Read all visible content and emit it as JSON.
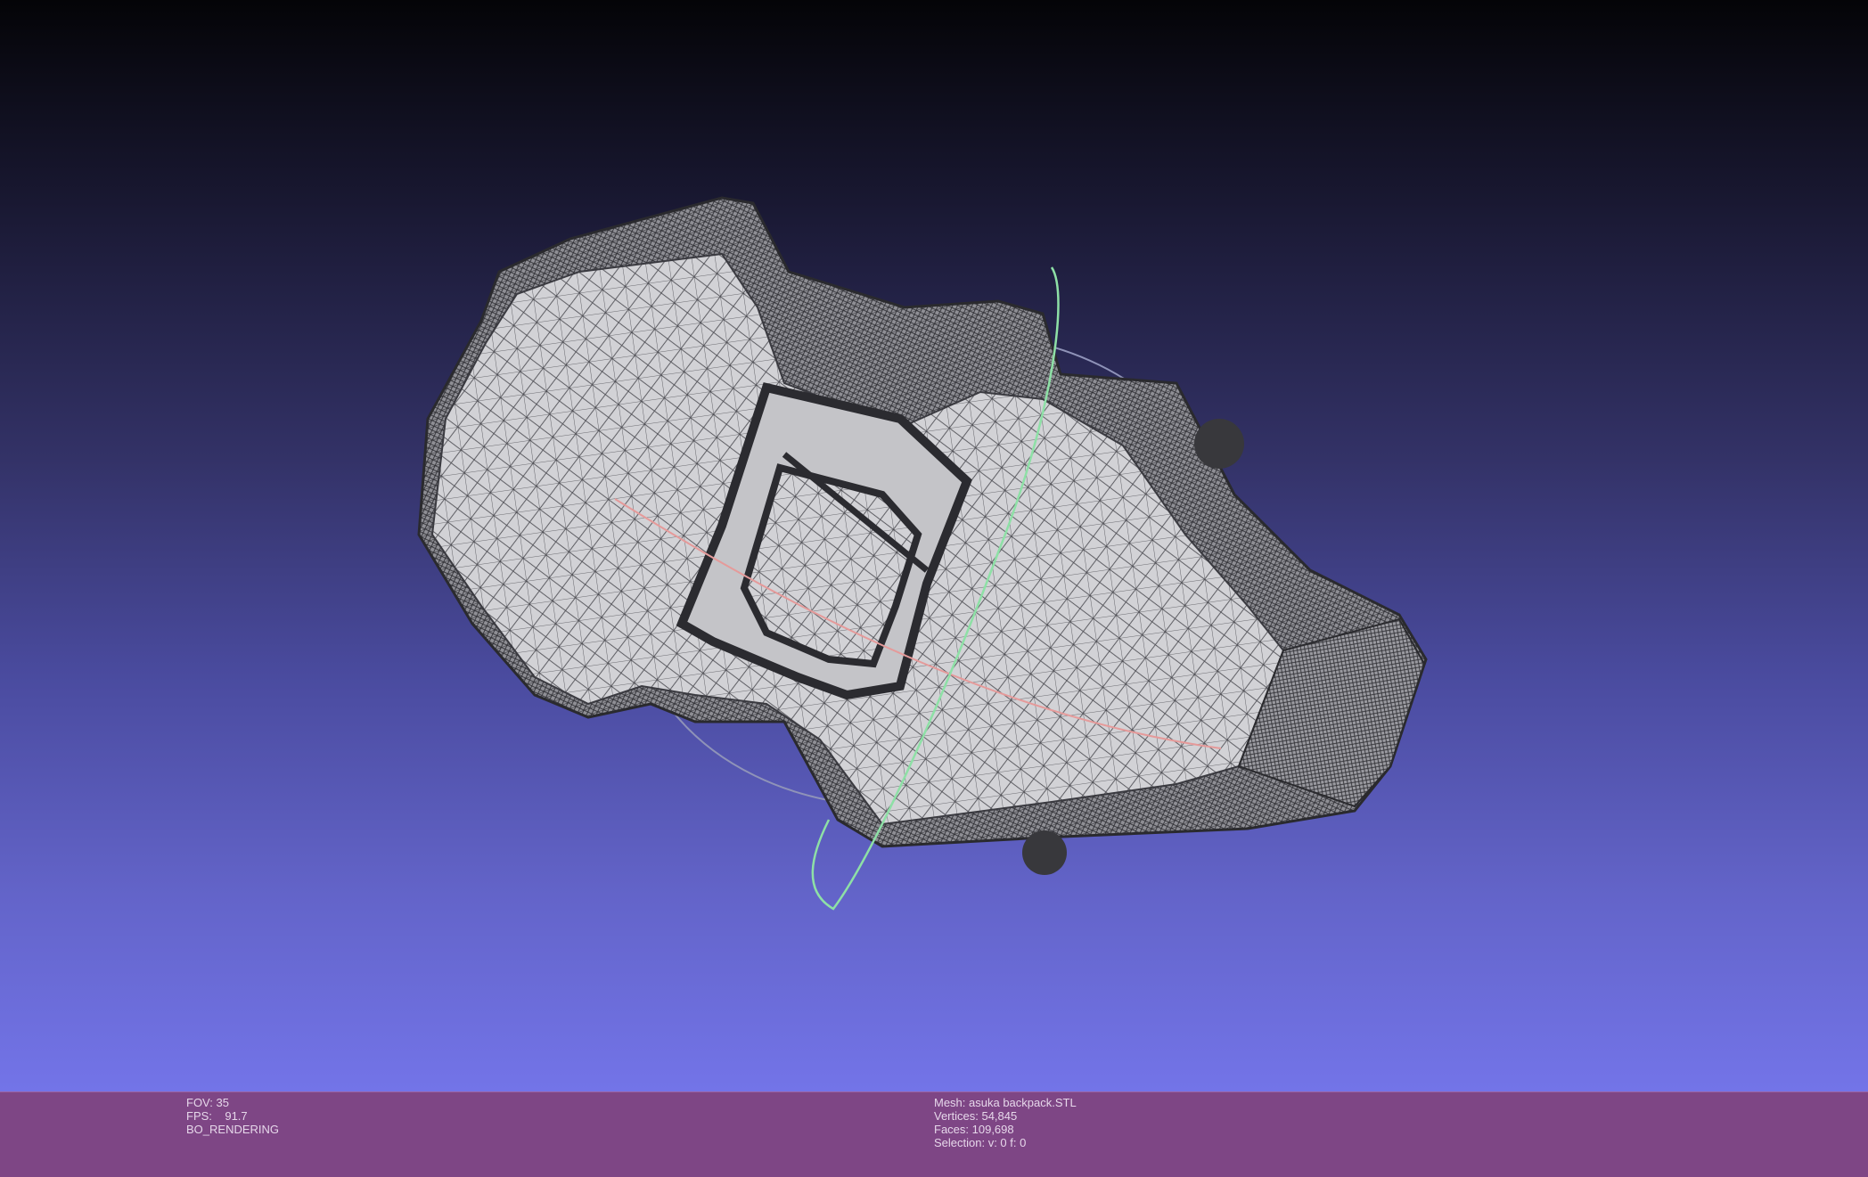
{
  "viewport": {
    "background_top": "#040407",
    "background_bottom": "#7374e8",
    "mesh_color": "#cfcfd3",
    "wire_color": "#3a3a3e",
    "trackball_colors": {
      "x": "#e08080",
      "y": "#7fe09a",
      "z": "#9aa0c8"
    }
  },
  "status": {
    "background": "#7e4685",
    "left": {
      "fov": "FOV: 35",
      "fps": "FPS:    91.7",
      "mode": "BO_RENDERING"
    },
    "right": {
      "mesh": "Mesh: asuka backpack.STL",
      "vertices": "Vertices: 54,845",
      "faces": "Faces: 109,698",
      "selection": "Selection: v: 0 f: 0"
    }
  }
}
